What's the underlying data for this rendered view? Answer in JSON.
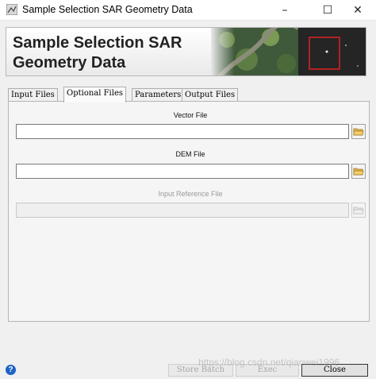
{
  "window": {
    "title": "Sample Selection SAR Geometry Data",
    "controls": {
      "minimize": "–",
      "maximize": "☐",
      "close": "✕"
    }
  },
  "header": {
    "title": "Sample Selection SAR\nGeometry Data"
  },
  "tabs": [
    {
      "label": "Input Files",
      "active": false
    },
    {
      "label": "Optional Files",
      "active": true
    },
    {
      "label": "Parameters",
      "active": false
    },
    {
      "label": "Output Files",
      "active": false
    }
  ],
  "fields": {
    "vector": {
      "label": "Vector File",
      "value": "",
      "enabled": true
    },
    "dem": {
      "label": "DEM File",
      "value": "",
      "enabled": true
    },
    "reference": {
      "label": "Input Reference File",
      "value": "",
      "enabled": false
    }
  },
  "buttons": {
    "help": "?",
    "store_batch": "Store Batch",
    "exec": "Exec",
    "close": "Close"
  },
  "watermark": "https://blog.csdn.net/qianwei1996"
}
